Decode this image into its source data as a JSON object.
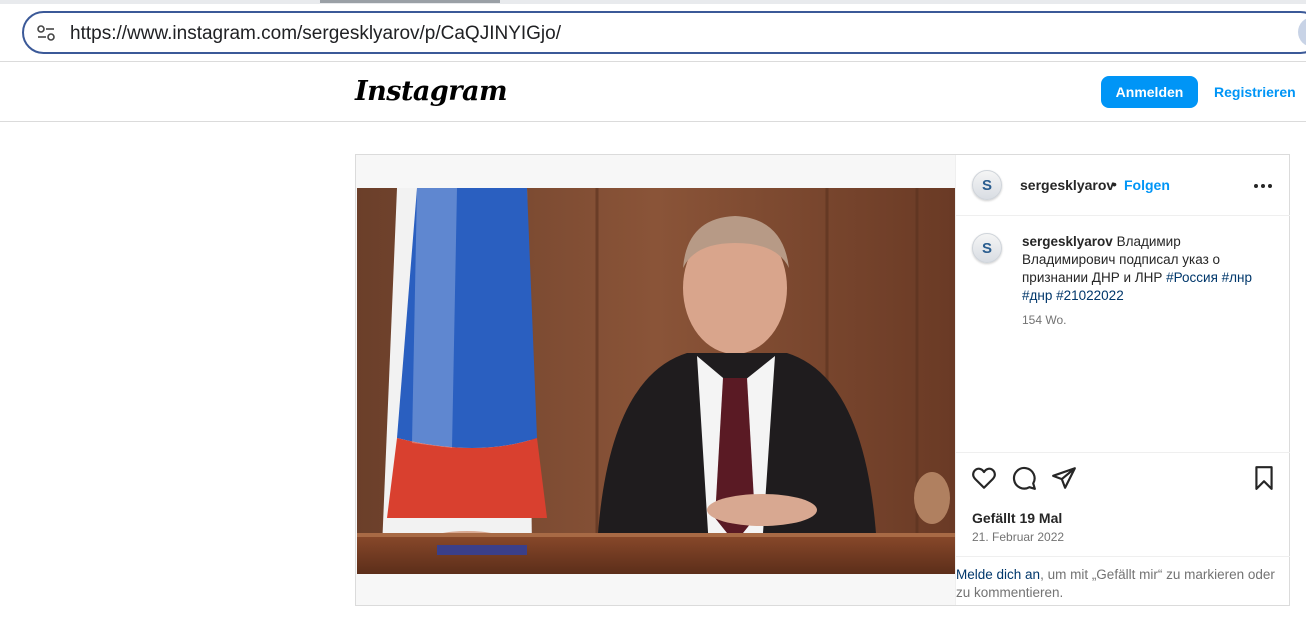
{
  "browser": {
    "url": "https://www.instagram.com/sergesklyarov/p/CaQJINYIGjo/",
    "icons": {
      "site_settings": "tune-icon",
      "profile": "profile-avatar"
    }
  },
  "header": {
    "logo_text": "Instagram",
    "login_label": "Anmelden",
    "register_label": "Registrieren",
    "accent_color": "#0095f6"
  },
  "post": {
    "username": "sergesklyarov",
    "avatar_letter": "S",
    "separator": "•",
    "follow_label": "Folgen",
    "more_icon": "more-horizontal-icon",
    "caption": {
      "username": "sergesklyarov",
      "text": "Владимир Владимирович подписал указ о признании ДНР и ЛНР",
      "hashtags": [
        "#Россия",
        "#лнр",
        "#днр",
        "#21022022"
      ],
      "age": "154 Wo."
    },
    "actions": {
      "icons": [
        "heart-icon",
        "comment-icon",
        "share-icon",
        "bookmark-icon"
      ]
    },
    "likes": "Gefällt 19 Mal",
    "date": "21. Februar 2022",
    "login_prompt": {
      "link": "Melde dich an",
      "text": ", um mit „Gefällt mir“ zu markieren oder zu kommentieren."
    }
  }
}
